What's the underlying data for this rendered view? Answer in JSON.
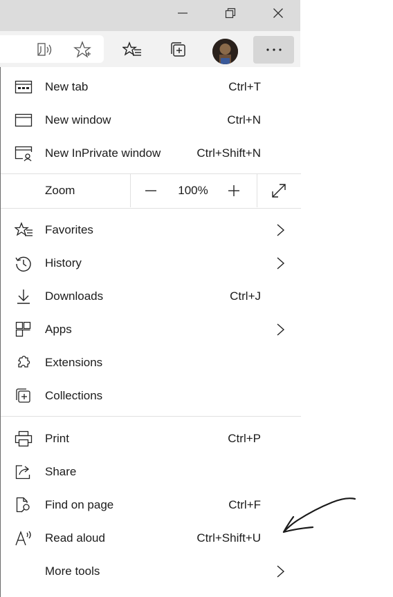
{
  "window_controls": {
    "minimize_icon": "minimize-icon",
    "restore_icon": "restore-icon",
    "close_icon": "close-icon"
  },
  "toolbar": {
    "icons": [
      "read-aloud-icon",
      "favorite-star-icon",
      "favorites-list-icon",
      "collections-icon",
      "profile-avatar",
      "more-dots-icon"
    ]
  },
  "menu": {
    "group1": [
      {
        "label": "New tab",
        "shortcut": "Ctrl+T",
        "icon": "new-tab-icon"
      },
      {
        "label": "New window",
        "shortcut": "Ctrl+N",
        "icon": "new-window-icon"
      },
      {
        "label": "New InPrivate window",
        "shortcut": "Ctrl+Shift+N",
        "icon": "inprivate-icon"
      }
    ],
    "zoom": {
      "label": "Zoom",
      "value": "100%",
      "minus": "–",
      "plus": "+"
    },
    "group2": [
      {
        "label": "Favorites",
        "shortcut": "",
        "icon": "favorites-icon",
        "submenu": true
      },
      {
        "label": "History",
        "shortcut": "",
        "icon": "history-icon",
        "submenu": true
      },
      {
        "label": "Downloads",
        "shortcut": "Ctrl+J",
        "icon": "download-icon",
        "submenu": false
      },
      {
        "label": "Apps",
        "shortcut": "",
        "icon": "apps-icon",
        "submenu": true
      },
      {
        "label": "Extensions",
        "shortcut": "",
        "icon": "extensions-icon",
        "submenu": false
      },
      {
        "label": "Collections",
        "shortcut": "",
        "icon": "collections-icon",
        "submenu": false
      }
    ],
    "group3": [
      {
        "label": "Print",
        "shortcut": "Ctrl+P",
        "icon": "print-icon",
        "submenu": false
      },
      {
        "label": "Share",
        "shortcut": "",
        "icon": "share-icon",
        "submenu": false
      },
      {
        "label": "Find on page",
        "shortcut": "Ctrl+F",
        "icon": "find-icon",
        "submenu": false
      },
      {
        "label": "Read aloud",
        "shortcut": "Ctrl+Shift+U",
        "icon": "read-aloud-icon",
        "submenu": false
      },
      {
        "label": "More tools",
        "shortcut": "",
        "icon": "",
        "submenu": true
      }
    ]
  },
  "annotation": {
    "type": "hand-drawn-arrow",
    "points_to": "Read aloud",
    "color": "#1a1a1a"
  },
  "colors": {
    "titlebar": "#dcdcdc",
    "toolbar": "#f2f2f2",
    "menu_bg": "#ffffff",
    "separator": "#e0e0e0",
    "active_button": "#d6d6d6"
  }
}
